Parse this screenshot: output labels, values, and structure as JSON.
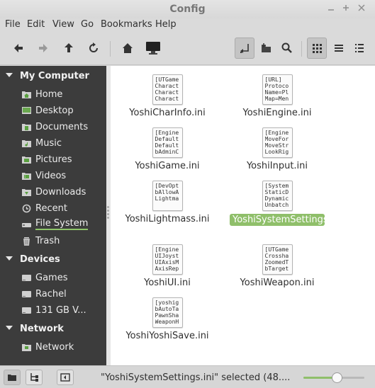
{
  "window": {
    "title": "Config"
  },
  "menu": [
    "File",
    "Edit",
    "View",
    "Go",
    "Bookmarks",
    "Help"
  ],
  "sidebar": {
    "my_computer": {
      "title": "My Computer",
      "items": [
        "Home",
        "Desktop",
        "Documents",
        "Music",
        "Pictures",
        "Videos",
        "Downloads",
        "Recent",
        "File System",
        "Trash"
      ]
    },
    "devices": {
      "title": "Devices",
      "items": [
        "Games",
        "Rachel",
        "131 GB V..."
      ]
    },
    "network": {
      "title": "Network",
      "items": [
        "Network"
      ]
    }
  },
  "files": [
    {
      "name": "YoshiCharInfo.ini",
      "preview": [
        "[UTGame",
        "Charact",
        "Charact",
        "Charact"
      ]
    },
    {
      "name": "YoshiEngine.ini",
      "preview": [
        "[URL]",
        "Protoco",
        "Name=Pl",
        "Map=Men"
      ]
    },
    {
      "name": "YoshiGame.ini",
      "preview": [
        "[Engine",
        "Default",
        "Default",
        "bAdminC"
      ]
    },
    {
      "name": "YoshiInput.ini",
      "preview": [
        "[Engine",
        "MoveFor",
        "MoveStr",
        "LookRig"
      ]
    },
    {
      "name": "YoshiLightmass.ini",
      "preview": [
        "[DevOpt",
        "bAllowA",
        "Lightma",
        ""
      ]
    },
    {
      "name": "YoshiSystemSettings.ini",
      "preview": [
        "[System",
        "StaticD",
        "Dynamic",
        "Unbatch"
      ]
    },
    {
      "name": "YoshiUI.ini",
      "preview": [
        "[Engine",
        "UIJoyst",
        "UIAxisM",
        "AxisRep"
      ]
    },
    {
      "name": "YoshiWeapon.ini",
      "preview": [
        "[UTGame",
        "Crossha",
        "ZoomedT",
        "bTarget"
      ]
    },
    {
      "name": "YoshiYoshiSave.ini",
      "preview": [
        "[yoshig",
        "bAutoTa",
        "PawnSha",
        "WeaponH"
      ]
    }
  ],
  "status": {
    "text": "\"YoshiSystemSettings.ini\" selected (48....",
    "zoom_fraction": 0.55
  },
  "colors": {
    "accent": "#8fbf6a",
    "sidebar_bg": "#3c3c3c"
  }
}
